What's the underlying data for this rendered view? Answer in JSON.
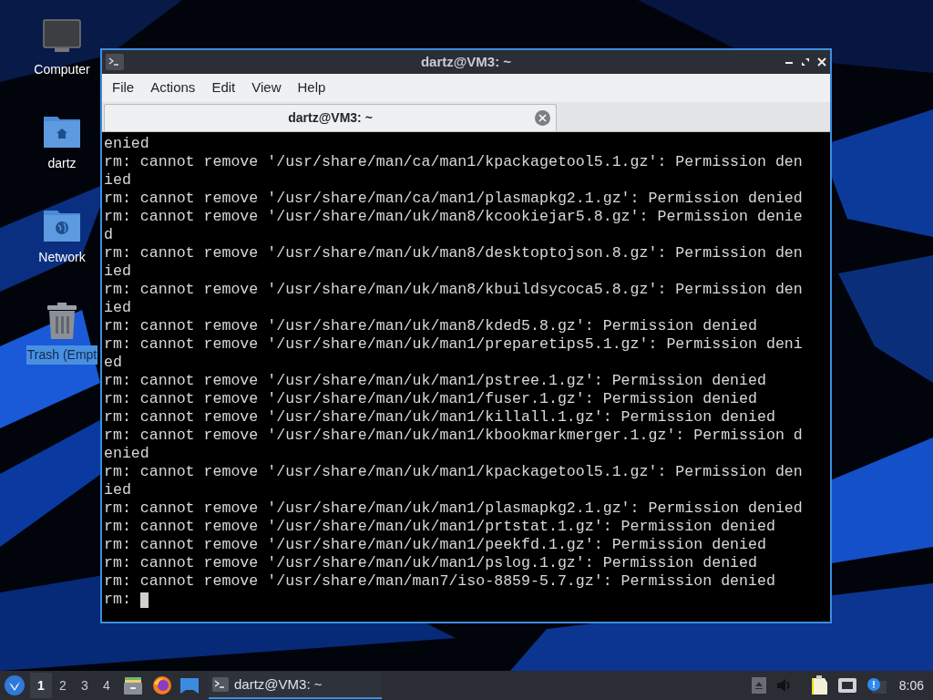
{
  "desktop_icons": [
    {
      "kind": "computer",
      "label": "Computer",
      "selected": false
    },
    {
      "kind": "home",
      "label": "dartz",
      "selected": false
    },
    {
      "kind": "network",
      "label": "Network",
      "selected": false
    },
    {
      "kind": "trash",
      "label": "Trash (Empt",
      "selected": true
    }
  ],
  "window": {
    "title": "dartz@VM3: ~",
    "menu": [
      "File",
      "Actions",
      "Edit",
      "View",
      "Help"
    ],
    "tabs": [
      {
        "label": "dartz@VM3: ~",
        "selected": true
      }
    ],
    "terminal_lines": [
      "enied",
      "rm: cannot remove '/usr/share/man/ca/man1/kpackagetool5.1.gz': Permission den",
      "ied",
      "rm: cannot remove '/usr/share/man/ca/man1/plasmapkg2.1.gz': Permission denied",
      "rm: cannot remove '/usr/share/man/uk/man8/kcookiejar5.8.gz': Permission denie",
      "d",
      "rm: cannot remove '/usr/share/man/uk/man8/desktoptojson.8.gz': Permission den",
      "ied",
      "rm: cannot remove '/usr/share/man/uk/man8/kbuildsycoca5.8.gz': Permission den",
      "ied",
      "rm: cannot remove '/usr/share/man/uk/man8/kded5.8.gz': Permission denied",
      "rm: cannot remove '/usr/share/man/uk/man1/preparetips5.1.gz': Permission deni",
      "ed",
      "rm: cannot remove '/usr/share/man/uk/man1/pstree.1.gz': Permission denied",
      "rm: cannot remove '/usr/share/man/uk/man1/fuser.1.gz': Permission denied",
      "rm: cannot remove '/usr/share/man/uk/man1/killall.1.gz': Permission denied",
      "rm: cannot remove '/usr/share/man/uk/man1/kbookmarkmerger.1.gz': Permission d",
      "enied",
      "rm: cannot remove '/usr/share/man/uk/man1/kpackagetool5.1.gz': Permission den",
      "ied",
      "rm: cannot remove '/usr/share/man/uk/man1/plasmapkg2.1.gz': Permission denied",
      "rm: cannot remove '/usr/share/man/uk/man1/prtstat.1.gz': Permission denied",
      "rm: cannot remove '/usr/share/man/uk/man1/peekfd.1.gz': Permission denied",
      "rm: cannot remove '/usr/share/man/uk/man1/pslog.1.gz': Permission denied",
      "rm: cannot remove '/usr/share/man/man7/iso-8859-5.7.gz': Permission denied",
      "rm: "
    ]
  },
  "taskbar": {
    "workspaces": [
      {
        "label": "1",
        "selected": true
      },
      {
        "label": "2",
        "selected": false
      },
      {
        "label": "3",
        "selected": false
      },
      {
        "label": "4",
        "selected": false
      }
    ],
    "tasks": [
      {
        "label": "dartz@VM3: ~",
        "selected": true
      }
    ],
    "clock": "8:06"
  }
}
